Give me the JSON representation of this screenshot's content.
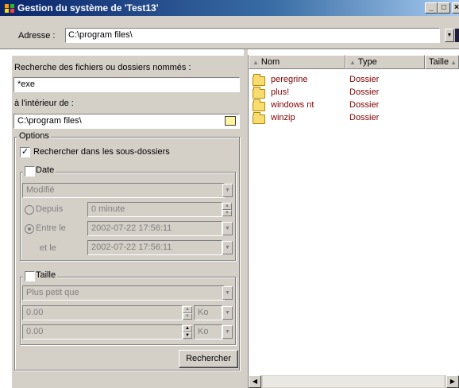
{
  "window": {
    "title": "Gestion du système de 'Test13'",
    "minimize": "_",
    "maximize": "□",
    "close": "×"
  },
  "address": {
    "label": "Adresse :",
    "value": "C:\\program files\\"
  },
  "search": {
    "name_label": "Recherche des fichiers ou dossiers nommés :",
    "name_value": "*exe",
    "inside_label": "à l'intérieur de :",
    "inside_value": "C:\\program files\\",
    "options_legend": "Options",
    "subfolders_label": "Rechercher dans les sous-dossiers",
    "subfolders_checked": true,
    "date": {
      "label": "Date",
      "checked": false,
      "mode_value": "Modifié",
      "since_label": "Depuis",
      "since_value": "0 minute",
      "between_label": "Entre le",
      "between_value": "2002-07-22 17:56:11",
      "and_label": "et le",
      "and_value": "2002-07-22 17:56:11"
    },
    "size": {
      "label": "Taille",
      "checked": false,
      "mode_value": "Plus petit que",
      "value1": "0.00",
      "unit1": "Ko",
      "value2": "0.00",
      "unit2": "Ko"
    },
    "search_button": "Rechercher"
  },
  "results": {
    "columns": [
      {
        "label": "Nom"
      },
      {
        "label": "Type"
      },
      {
        "label": "Taille"
      }
    ],
    "rows": [
      {
        "name": "peregrine",
        "type": "Dossier"
      },
      {
        "name": "plus!",
        "type": "Dossier"
      },
      {
        "name": "windows nt",
        "type": "Dossier"
      },
      {
        "name": "winzip",
        "type": "Dossier"
      }
    ]
  },
  "colors": {
    "titlebar_start": "#0a246a",
    "titlebar_end": "#a6caf0",
    "face": "#d4d0c8",
    "result_text": "#800000"
  }
}
